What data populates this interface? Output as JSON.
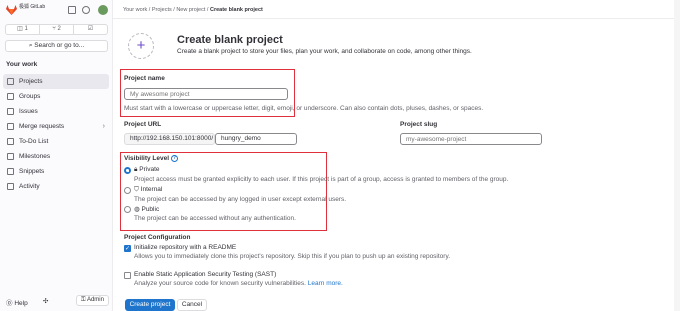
{
  "sidebar": {
    "brand": "极狐 GitLab",
    "counters": [
      "1",
      "2",
      ""
    ],
    "search": "Search or go to...",
    "section": "Your work",
    "items": [
      {
        "label": "Projects",
        "icon": "project-icon",
        "active": true
      },
      {
        "label": "Groups",
        "icon": "group-icon"
      },
      {
        "label": "Issues",
        "icon": "issues-icon"
      },
      {
        "label": "Merge requests",
        "icon": "merge-request-icon",
        "chevron": "›"
      },
      {
        "label": "To-Do List",
        "icon": "todo-icon"
      },
      {
        "label": "Milestones",
        "icon": "milestone-icon"
      },
      {
        "label": "Snippets",
        "icon": "snippet-icon"
      },
      {
        "label": "Activity",
        "icon": "activity-icon"
      }
    ],
    "help": "Help",
    "admin": "Admin"
  },
  "breadcrumb": {
    "c1": "Your work",
    "c2": "Projects",
    "c3": "New project",
    "current": "Create blank project",
    "sep": "/"
  },
  "page": {
    "title": "Create blank project",
    "description": "Create a blank project to store your files, plan your work, and collaborate on code, among other things."
  },
  "form": {
    "project_name_label": "Project name",
    "project_name_placeholder": "My awesome project",
    "project_name_help": "Must start with a lowercase or uppercase letter, digit, emoji, or underscore. Can also contain dots, pluses, dashes, or spaces.",
    "project_url_label": "Project URL",
    "project_url_prefix": "http://192.168.150.101:8000/",
    "project_url_namespace": "hungry_demo",
    "slug_separator": "/",
    "project_slug_label": "Project slug",
    "project_slug_placeholder": "my-awesome-project",
    "visibility_label": "Visibility Level",
    "visibility": [
      {
        "label": "Private",
        "help": "Project access must be granted explicitly to each user. If this project is part of a group, access is granted to members of the group.",
        "selected": true
      },
      {
        "label": "Internal",
        "help": "The project can be accessed by any logged in user except external users."
      },
      {
        "label": "Public",
        "help": "The project can be accessed without any authentication."
      }
    ],
    "config_label": "Project Configuration",
    "init_readme_label": "Initialize repository with a README",
    "init_readme_help": "Allows you to immediately clone this project's repository. Skip this if you plan to push up an existing repository.",
    "sast_label": "Enable Static Application Security Testing (SAST)",
    "sast_help": "Analyze your source code for known security vulnerabilities.",
    "sast_link": "Learn more.",
    "create_button": "Create project",
    "cancel_button": "Cancel"
  },
  "colors": {
    "accent": "#1f75cb",
    "highlight": "#e0303b",
    "brand": "#e24329"
  }
}
